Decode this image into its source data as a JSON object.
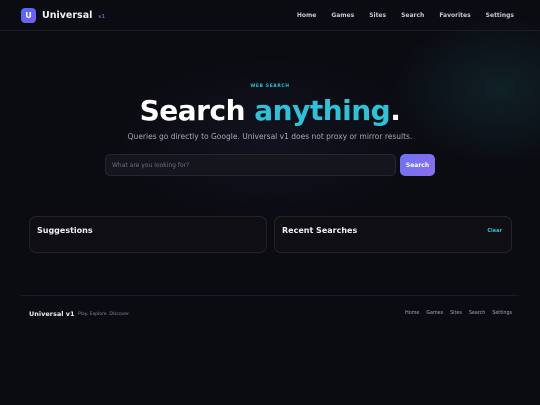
{
  "header": {
    "logo_letter": "U",
    "brand_name": "Universal",
    "brand_version": "v1",
    "nav": [
      "Home",
      "Games",
      "Sites",
      "Search",
      "Favorites",
      "Settings"
    ]
  },
  "hero": {
    "eyebrow": "WEB SEARCH",
    "title_main": "Search ",
    "title_accent": "anything",
    "title_end": ".",
    "subtitle": "Queries go directly to Google. Universal v1 does not proxy or mirror results."
  },
  "search": {
    "placeholder": "What are you looking for?",
    "value": "",
    "button_label": "Search"
  },
  "panels": {
    "suggestions_title": "Suggestions",
    "recent_title": "Recent Searches",
    "clear_label": "Clear"
  },
  "footer": {
    "brand": "Universal v1",
    "tagline": "Play. Explore. Discover.",
    "nav": [
      "Home",
      "Games",
      "Sites",
      "Search",
      "Settings"
    ]
  },
  "colors": {
    "background": "#0b0b12",
    "accent_cyan": "#2ec2d9",
    "accent_purple": "#7a6cf2"
  },
  "icons": {
    "logo": "universal-logo-icon"
  }
}
